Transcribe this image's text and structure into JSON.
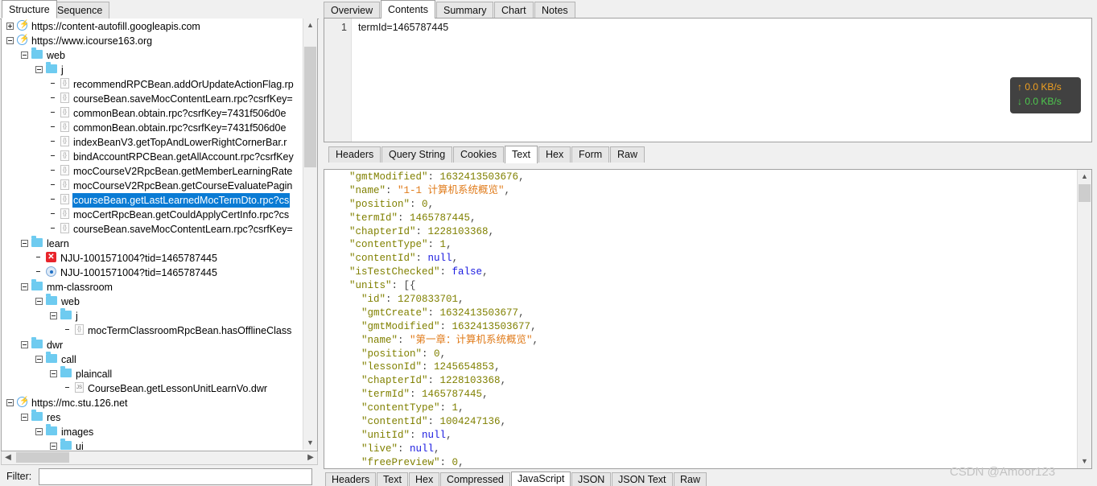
{
  "left_panel": {
    "tabs": [
      {
        "label": "Structure",
        "selected": true
      },
      {
        "label": "Sequence",
        "selected": false
      }
    ],
    "filter": {
      "label": "Filter:",
      "value": "",
      "placeholder": ""
    },
    "tree": [
      {
        "indent": 0,
        "expander": "plus",
        "icon": "host-icon",
        "label": "https://content-autofill.googleapis.com",
        "selected": false
      },
      {
        "indent": 0,
        "expander": "minus",
        "icon": "host-icon",
        "label": "https://www.icourse163.org",
        "selected": false
      },
      {
        "indent": 1,
        "expander": "minus",
        "icon": "folder-icon",
        "label": "web",
        "selected": false
      },
      {
        "indent": 2,
        "expander": "minus",
        "icon": "folder-icon",
        "label": "j",
        "selected": false
      },
      {
        "indent": 3,
        "expander": "none",
        "icon": "json-file-icon",
        "label": "recommendRPCBean.addOrUpdateActionFlag.rp",
        "selected": false
      },
      {
        "indent": 3,
        "expander": "none",
        "icon": "json-file-icon",
        "label": "courseBean.saveMocContentLearn.rpc?csrfKey=",
        "selected": false
      },
      {
        "indent": 3,
        "expander": "none",
        "icon": "json-file-icon",
        "label": "commonBean.obtain.rpc?csrfKey=7431f506d0e",
        "selected": false
      },
      {
        "indent": 3,
        "expander": "none",
        "icon": "json-file-icon",
        "label": "commonBean.obtain.rpc?csrfKey=7431f506d0e",
        "selected": false
      },
      {
        "indent": 3,
        "expander": "none",
        "icon": "json-file-icon",
        "label": "indexBeanV3.getTopAndLowerRightCornerBar.r",
        "selected": false
      },
      {
        "indent": 3,
        "expander": "none",
        "icon": "json-file-icon",
        "label": "bindAccountRPCBean.getAllAccount.rpc?csrfKey",
        "selected": false
      },
      {
        "indent": 3,
        "expander": "none",
        "icon": "json-file-icon",
        "label": "mocCourseV2RpcBean.getMemberLearningRate",
        "selected": false
      },
      {
        "indent": 3,
        "expander": "none",
        "icon": "json-file-icon",
        "label": "mocCourseV2RpcBean.getCourseEvaluatePagin",
        "selected": false
      },
      {
        "indent": 3,
        "expander": "none",
        "icon": "json-file-icon",
        "label": "courseBean.getLastLearnedMocTermDto.rpc?cs",
        "selected": true
      },
      {
        "indent": 3,
        "expander": "none",
        "icon": "json-file-icon",
        "label": "mocCertRpcBean.getCouldApplyCertInfo.rpc?cs",
        "selected": false
      },
      {
        "indent": 3,
        "expander": "none",
        "icon": "json-file-icon",
        "label": "courseBean.saveMocContentLearn.rpc?csrfKey=",
        "selected": false
      },
      {
        "indent": 1,
        "expander": "minus",
        "icon": "folder-icon",
        "label": "learn",
        "selected": false
      },
      {
        "indent": 2,
        "expander": "none",
        "icon": "error-icon",
        "label": "NJU-1001571004?tid=1465787445",
        "selected": false
      },
      {
        "indent": 2,
        "expander": "none",
        "icon": "globe-icon",
        "label": "NJU-1001571004?tid=1465787445",
        "selected": false
      },
      {
        "indent": 1,
        "expander": "minus",
        "icon": "folder-icon",
        "label": "mm-classroom",
        "selected": false
      },
      {
        "indent": 2,
        "expander": "minus",
        "icon": "folder-icon",
        "label": "web",
        "selected": false
      },
      {
        "indent": 3,
        "expander": "minus",
        "icon": "folder-icon",
        "label": "j",
        "selected": false
      },
      {
        "indent": 4,
        "expander": "none",
        "icon": "json-file-icon",
        "label": "mocTermClassroomRpcBean.hasOfflineClass",
        "selected": false
      },
      {
        "indent": 1,
        "expander": "minus",
        "icon": "folder-icon",
        "label": "dwr",
        "selected": false
      },
      {
        "indent": 2,
        "expander": "minus",
        "icon": "folder-icon",
        "label": "call",
        "selected": false
      },
      {
        "indent": 3,
        "expander": "minus",
        "icon": "folder-icon",
        "label": "plaincall",
        "selected": false
      },
      {
        "indent": 4,
        "expander": "none",
        "icon": "js-file-icon",
        "label": "CourseBean.getLessonUnitLearnVo.dwr",
        "selected": false
      },
      {
        "indent": 0,
        "expander": "minus",
        "icon": "host-icon",
        "label": "https://mc.stu.126.net",
        "selected": false
      },
      {
        "indent": 1,
        "expander": "minus",
        "icon": "folder-icon",
        "label": "res",
        "selected": false
      },
      {
        "indent": 2,
        "expander": "minus",
        "icon": "folder-icon",
        "label": "images",
        "selected": false
      },
      {
        "indent": 3,
        "expander": "minus",
        "icon": "folder-icon",
        "label": "ui",
        "selected": false
      }
    ]
  },
  "request_panel": {
    "tabs": [
      {
        "label": "Overview",
        "selected": false
      },
      {
        "label": "Contents",
        "selected": true
      },
      {
        "label": "Summary",
        "selected": false
      },
      {
        "label": "Chart",
        "selected": false
      },
      {
        "label": "Notes",
        "selected": false
      }
    ],
    "view_tabs": [
      {
        "label": "Headers",
        "selected": false
      },
      {
        "label": "Query String",
        "selected": false
      },
      {
        "label": "Cookies",
        "selected": false
      },
      {
        "label": "Text",
        "selected": true
      },
      {
        "label": "Hex",
        "selected": false
      },
      {
        "label": "Form",
        "selected": false
      },
      {
        "label": "Raw",
        "selected": false
      }
    ],
    "content": {
      "line_number": "1",
      "text": "termId=1465787445"
    }
  },
  "response_panel": {
    "view_tabs": [
      {
        "label": "Headers",
        "selected": false
      },
      {
        "label": "Text",
        "selected": false
      },
      {
        "label": "Hex",
        "selected": false
      },
      {
        "label": "Compressed",
        "selected": false
      },
      {
        "label": "JavaScript",
        "selected": true
      },
      {
        "label": "JSON",
        "selected": false
      },
      {
        "label": "JSON Text",
        "selected": false
      },
      {
        "label": "Raw",
        "selected": false
      }
    ],
    "json_lines": [
      {
        "indent": 4,
        "key": "gmtModified",
        "sep": ": ",
        "value": "1632413503676",
        "type": "num",
        "trail": ","
      },
      {
        "indent": 4,
        "key": "name",
        "sep": ": ",
        "value": "\"1-1 计算机系统概览\"",
        "type": "str",
        "trail": ","
      },
      {
        "indent": 4,
        "key": "position",
        "sep": ": ",
        "value": "0",
        "type": "num",
        "trail": ","
      },
      {
        "indent": 4,
        "key": "termId",
        "sep": ": ",
        "value": "1465787445",
        "type": "num",
        "trail": ","
      },
      {
        "indent": 4,
        "key": "chapterId",
        "sep": ": ",
        "value": "1228103368",
        "type": "num",
        "trail": ","
      },
      {
        "indent": 4,
        "key": "contentType",
        "sep": ": ",
        "value": "1",
        "type": "num",
        "trail": ","
      },
      {
        "indent": 4,
        "key": "contentId",
        "sep": ": ",
        "value": "null",
        "type": "kw",
        "trail": ","
      },
      {
        "indent": 4,
        "key": "isTestChecked",
        "sep": ": ",
        "value": "false",
        "type": "kw",
        "trail": ","
      },
      {
        "indent": 4,
        "key": "units",
        "sep": ": ",
        "value": "[{",
        "type": "pun",
        "trail": ""
      },
      {
        "indent": 6,
        "key": "id",
        "sep": ": ",
        "value": "1270833701",
        "type": "num",
        "trail": ","
      },
      {
        "indent": 6,
        "key": "gmtCreate",
        "sep": ": ",
        "value": "1632413503677",
        "type": "num",
        "trail": ","
      },
      {
        "indent": 6,
        "key": "gmtModified",
        "sep": ": ",
        "value": "1632413503677",
        "type": "num",
        "trail": ","
      },
      {
        "indent": 6,
        "key": "name",
        "sep": ": ",
        "value": "\"第一章：计算机系统概览\"",
        "type": "str",
        "trail": ","
      },
      {
        "indent": 6,
        "key": "position",
        "sep": ": ",
        "value": "0",
        "type": "num",
        "trail": ","
      },
      {
        "indent": 6,
        "key": "lessonId",
        "sep": ": ",
        "value": "1245654853",
        "type": "num",
        "trail": ","
      },
      {
        "indent": 6,
        "key": "chapterId",
        "sep": ": ",
        "value": "1228103368",
        "type": "num",
        "trail": ","
      },
      {
        "indent": 6,
        "key": "termId",
        "sep": ": ",
        "value": "1465787445",
        "type": "num",
        "trail": ","
      },
      {
        "indent": 6,
        "key": "contentType",
        "sep": ": ",
        "value": "1",
        "type": "num",
        "trail": ","
      },
      {
        "indent": 6,
        "key": "contentId",
        "sep": ": ",
        "value": "1004247136",
        "type": "num",
        "trail": ","
      },
      {
        "indent": 6,
        "key": "unitId",
        "sep": ": ",
        "value": "null",
        "type": "kw",
        "trail": ","
      },
      {
        "indent": 6,
        "key": "live",
        "sep": ": ",
        "value": "null",
        "type": "kw",
        "trail": ","
      },
      {
        "indent": 6,
        "key": "freePreview",
        "sep": ": ",
        "value": "0",
        "type": "num",
        "trail": ","
      }
    ]
  },
  "speed_widget": {
    "upload": "0.0 KB/s",
    "download": "0.0 KB/s",
    "up_arrow": "↑",
    "down_arrow": "↓"
  },
  "watermark": "CSDN @Amoor123"
}
